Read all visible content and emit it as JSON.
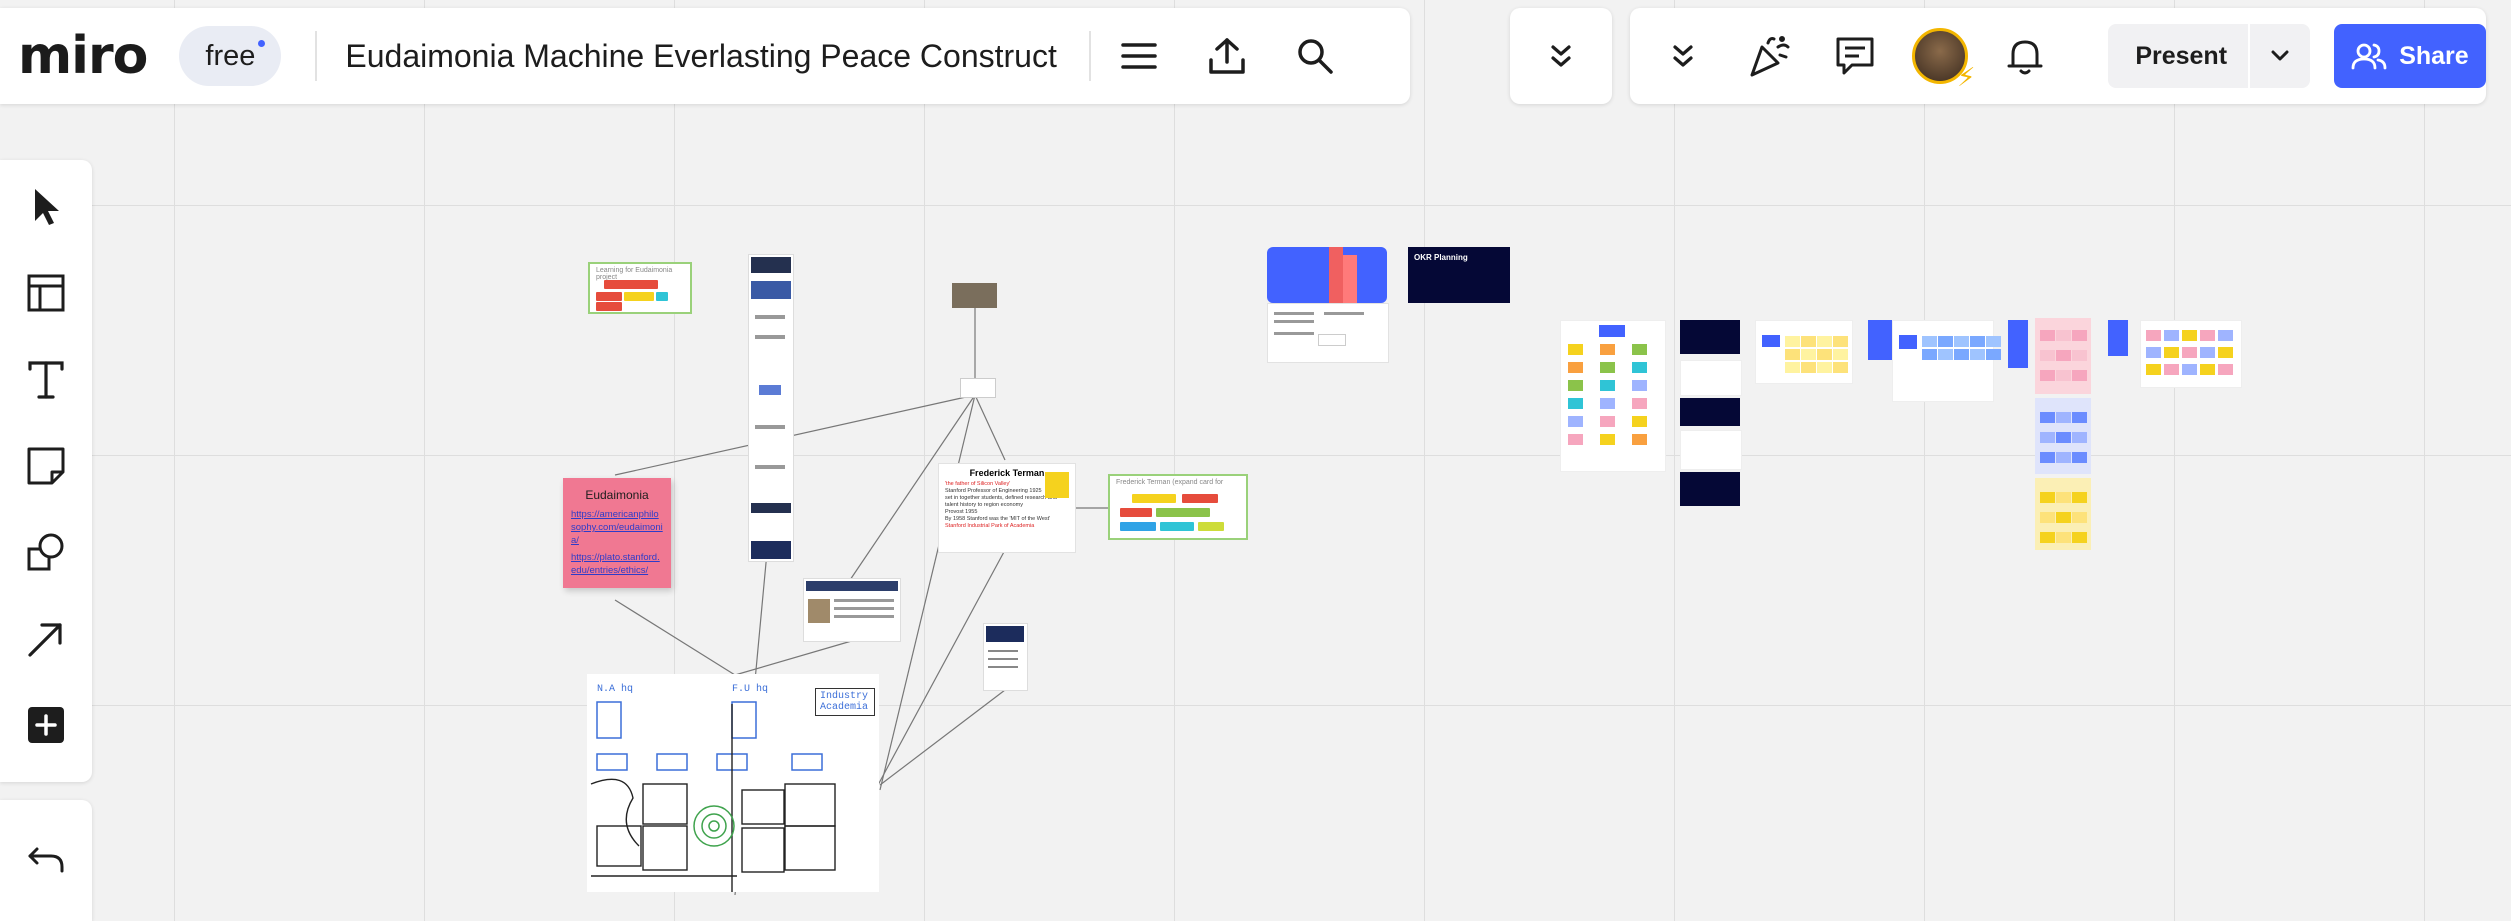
{
  "app": {
    "logo": "miro",
    "plan_badge": "free",
    "board_title": "Eudaimonia Machine Everlasting Peace Construct"
  },
  "topbar_icons": [
    "menu-icon",
    "export-icon",
    "search-icon"
  ],
  "right_toolbar": {
    "icons": [
      "chevron-double-down-icon",
      "reactions-icon",
      "comments-icon",
      "avatar",
      "notifications-icon"
    ],
    "present_label": "Present",
    "share_label": "Share"
  },
  "tools": [
    "select-tool",
    "templates-tool",
    "text-tool",
    "sticky-note-tool",
    "shapes-tool",
    "connector-tool",
    "more-tools"
  ],
  "canvas": {
    "sticky_eudaimonia": {
      "title": "Eudaimonia",
      "links": [
        "https://americanphilosophy.com/eudaimonia/",
        "https://plato.stanford.edu/entries/ethics/"
      ]
    },
    "card_terman": {
      "title": "Frederick Terman",
      "lines": [
        "'the father of Silicon Valley'",
        "Stanford Professor of Engineering 1925",
        "set in together students, defined research and",
        "talent history to region economy",
        "Provost 1955",
        "By 1958 Stanford was the 'MIT of the West'"
      ],
      "highlight": "Stanford Industrial Park of Academia"
    },
    "frame_terman_label": "Frederick Terman (expand card for",
    "frame_top_label": "Learning for Eudaimonia project",
    "okr_title": "OKR Planning",
    "sketch": {
      "label_a": "N.A hq",
      "label_b": "F.U hq",
      "legend": [
        "Industry",
        "Academia"
      ]
    }
  },
  "colors": {
    "accent": "#4262ff",
    "sticky_pink": "#f07892",
    "avatar_ring": "#f3b600"
  }
}
